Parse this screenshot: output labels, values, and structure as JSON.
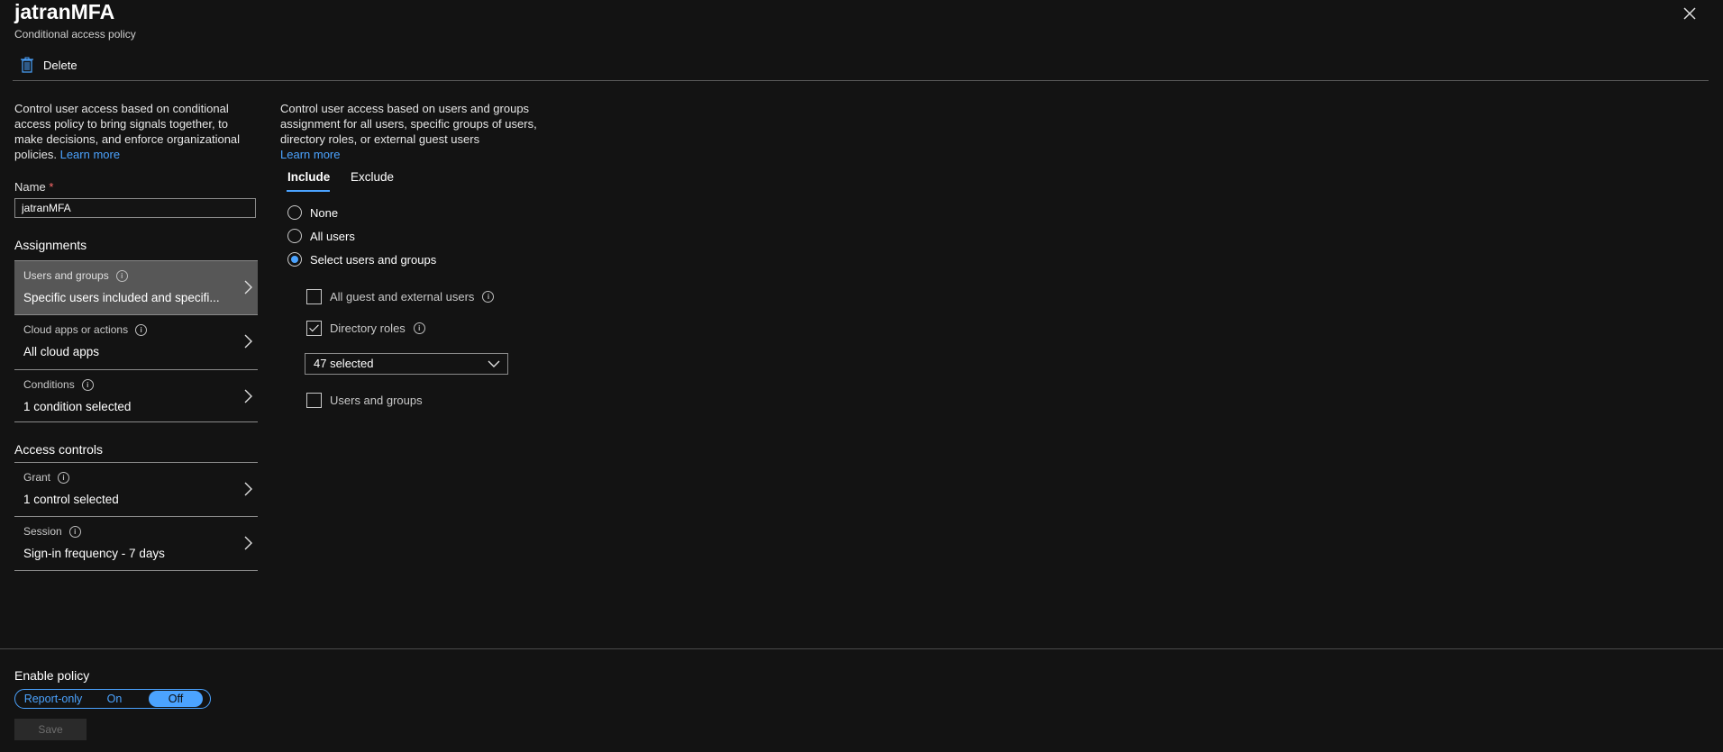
{
  "header": {
    "title": "jatranMFA",
    "subtitle": "Conditional access policy",
    "delete_label": "Delete"
  },
  "left": {
    "description": "Control user access based on conditional access policy to bring signals together, to make decisions, and enforce organizational policies.",
    "learn_more": "Learn more",
    "name_label": "Name",
    "name_required_marker": "*",
    "name_value": "jatranMFA",
    "assignments_title": "Assignments",
    "assignments": [
      {
        "label": "Users and groups",
        "value": "Specific users included and specifi..."
      },
      {
        "label": "Cloud apps or actions",
        "value": "All cloud apps"
      },
      {
        "label": "Conditions",
        "value": "1 condition selected"
      }
    ],
    "access_controls_title": "Access controls",
    "access_controls": [
      {
        "label": "Grant",
        "value": "1 control selected"
      },
      {
        "label": "Session",
        "value": "Sign-in frequency - 7 days"
      }
    ]
  },
  "right": {
    "description": "Control user access based on users and groups assignment for all users, specific groups of users, directory roles, or external guest users",
    "learn_more": "Learn more",
    "tabs": [
      {
        "label": "Include",
        "active": true
      },
      {
        "label": "Exclude",
        "active": false
      }
    ],
    "radios": [
      {
        "label": "None",
        "checked": false
      },
      {
        "label": "All users",
        "checked": false
      },
      {
        "label": "Select users and groups",
        "checked": true
      }
    ],
    "checkboxes": [
      {
        "label": "All guest and external users",
        "checked": false
      },
      {
        "label": "Directory roles",
        "checked": true
      },
      {
        "label": "Users and groups",
        "checked": false
      }
    ],
    "roles_dropdown_value": "47 selected"
  },
  "footer": {
    "enable_policy_label": "Enable policy",
    "toggle_options": [
      "Report-only",
      "On",
      "Off"
    ],
    "toggle_selected": "Off",
    "save_label": "Save"
  },
  "colors": {
    "accent": "#4ba3ff",
    "background": "#131313",
    "selected_row": "#575757"
  }
}
